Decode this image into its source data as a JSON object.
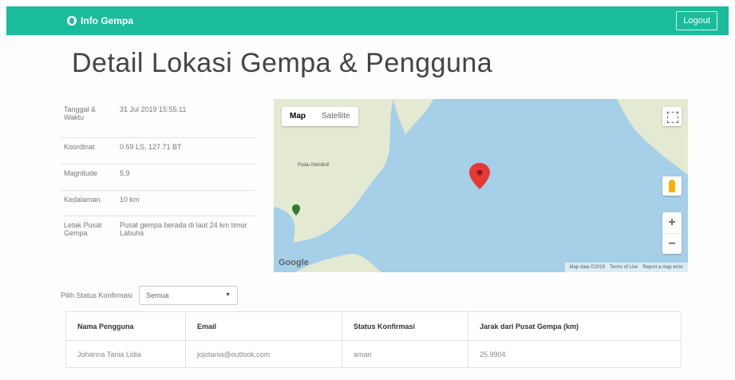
{
  "navbar": {
    "brand": "Info Gempa",
    "logout_label": "Logout"
  },
  "page": {
    "title": "Detail Lokasi Gempa & Pengguna"
  },
  "info": [
    {
      "label": "Tanggal & Waktu",
      "value": "31 Jul 2019 15:55:11"
    },
    {
      "label": "Koordinat",
      "value": "0.59 LS, 127.71 BT"
    },
    {
      "label": "Magnitude",
      "value": "5.9"
    },
    {
      "label": "Kedalaman",
      "value": "10 km"
    },
    {
      "label": "Letak Pusat Gempa",
      "value": "Pusat gempa berada di laut 24 km timur Labuha"
    }
  ],
  "map": {
    "tab_map": "Map",
    "tab_satellite": "Satellite",
    "zoom_in": "+",
    "zoom_out": "−",
    "google_label": "Google",
    "place_label": "Pulau Mandioli",
    "footer": [
      "Map data ©2019",
      "Terms of Use",
      "Report a map error"
    ],
    "colors": {
      "water": "#a6cfe8",
      "land": "#e6ead4",
      "marker_red": "#e53935",
      "marker_green": "#2e7d32"
    }
  },
  "filter": {
    "label": "Pilih Status Konfirmasi",
    "selected": "Semua"
  },
  "users_table": {
    "headers": [
      "Nama Pengguna",
      "Email",
      "Status Konfirmasi",
      "Jarak dari Pusat Gempa (km)"
    ],
    "rows": [
      [
        "Johanna Tania Lidia",
        "jojotania@outlook.com",
        "aman",
        "25.9904"
      ]
    ]
  }
}
